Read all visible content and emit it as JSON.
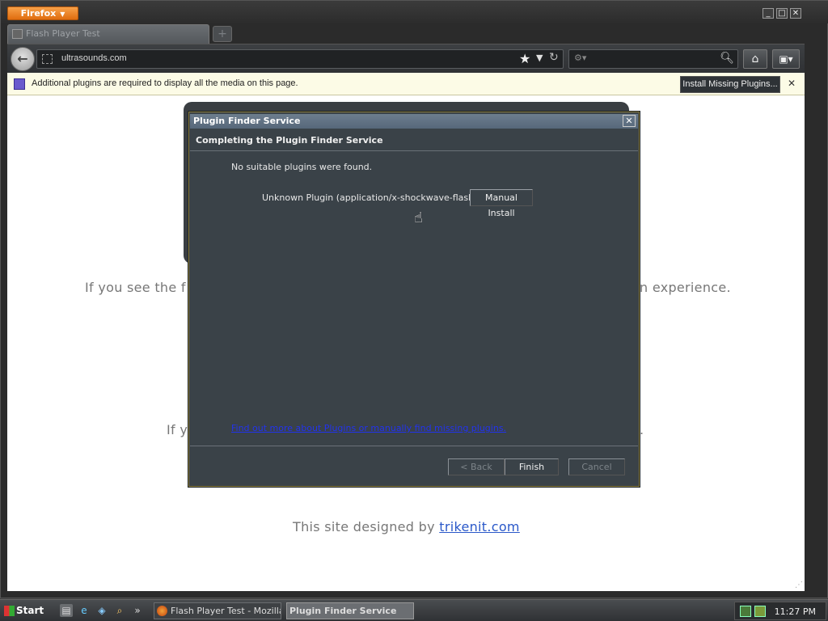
{
  "window": {
    "app_button": "Firefox",
    "controls": {
      "minimize": "_",
      "maximize": "□",
      "close": "✕"
    }
  },
  "tab": {
    "title": "Flash Player Test",
    "new_tab_symbol": "+"
  },
  "navbar": {
    "url": "ultrasounds.com",
    "search_placeholder": ""
  },
  "notification": {
    "message": "Additional plugins are required to display all the media on this page.",
    "install_button": "Install Missing Plugins...",
    "close_symbol": "✕"
  },
  "page": {
    "line1_left": "If you see the f",
    "line1_right": "n experience.",
    "line2_left": "If y",
    "line2_right": ".",
    "credit_prefix": "This site designed by ",
    "credit_link": "trikenit.com"
  },
  "dialog": {
    "title": "Plugin Finder Service",
    "close_symbol": "✕",
    "heading": "Completing the Plugin Finder Service",
    "message": "No suitable plugins were found.",
    "plugin_name": "Unknown Plugin (application/x-shockwave-flash)",
    "manual_install": "Manual Install",
    "info_link": "Find out more about Plugins or manually find missing plugins.",
    "back": "< Back",
    "finish": "Finish",
    "cancel": "Cancel"
  },
  "taskbar": {
    "start": "Start",
    "overflow": "»",
    "task_firefox": "Flash Player Test - Mozilla...",
    "task_dialog": "Plugin Finder Service",
    "clock": "11:27 PM"
  },
  "colors": {
    "firefox_orange": "#e97b1e",
    "dialog_bg": "#3a4248",
    "notification_bg": "#fcfbe6",
    "link_blue": "#2a58c9"
  }
}
